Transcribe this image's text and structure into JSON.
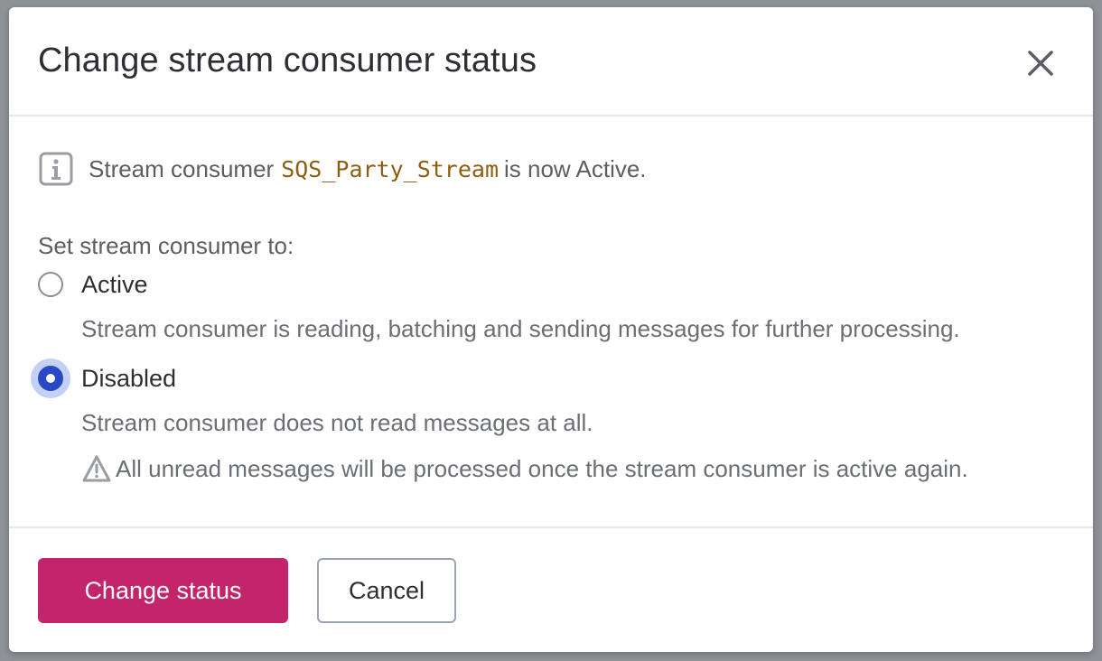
{
  "dialog": {
    "title": "Change stream consumer status",
    "close_icon": "close-icon"
  },
  "info": {
    "icon": "info-icon",
    "prefix": "Stream consumer",
    "consumer_name": "SQS_Party_Stream",
    "suffix": "is now Active."
  },
  "form": {
    "section_label": "Set stream consumer to:",
    "options": [
      {
        "label": "Active",
        "description": "Stream consumer is reading, batching and sending messages for further processing.",
        "selected": false
      },
      {
        "label": "Disabled",
        "description": "Stream consumer does not read messages at all.",
        "selected": true
      }
    ],
    "warning_icon": "warning-icon",
    "warning": "All unread messages will be processed once the stream consumer is active again."
  },
  "footer": {
    "primary_label": "Change status",
    "cancel_label": "Cancel"
  },
  "colors": {
    "primary": "#c4246b",
    "radio_selected": "#2848c4",
    "code": "#8e5e12"
  }
}
